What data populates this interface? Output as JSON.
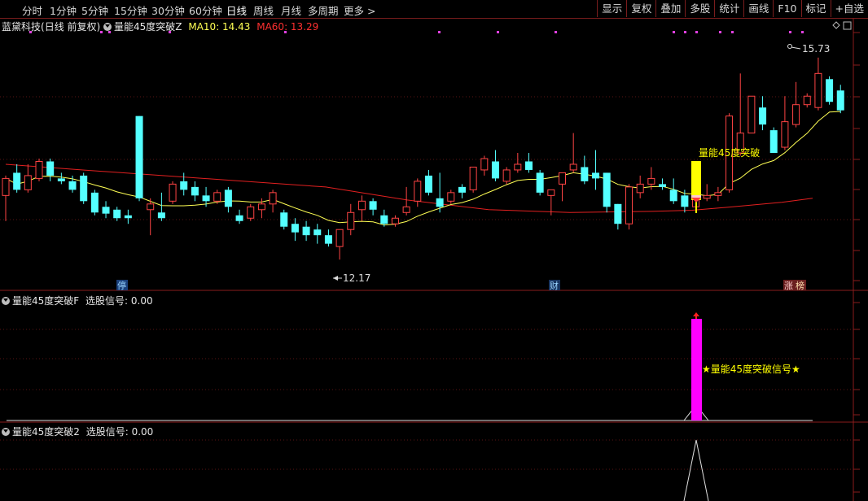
{
  "toolbar": {
    "timeframes": [
      "分时",
      "1分钟",
      "5分钟",
      "15分钟",
      "30分钟",
      "60分钟",
      "日线",
      "周线",
      "月线",
      "多周期",
      "更多 >"
    ],
    "active_timeframe": "日线",
    "tools": [
      "显示",
      "复权",
      "叠加",
      "多股",
      "统计",
      "画线",
      "F10",
      "标记",
      "+自选"
    ]
  },
  "main_pane": {
    "stock_name": "蓝黛科技",
    "period_label": "(日线 前复权)",
    "indicator_name": "量能45度突破Z",
    "ma10_label": "MA10: 14.43",
    "ma60_label": "MA60: 13.29",
    "high_annotation": "15.73",
    "low_annotation": "12.17",
    "signal_label": "量能45度突破",
    "badges": [
      "停",
      "财",
      "涨",
      "榜"
    ],
    "colors": {
      "up": "#ff4444",
      "down": "#54ffff",
      "ma10": "#ffff54",
      "ma60": "#e22020",
      "signal": "#ffff00",
      "dots": "#e040e0"
    }
  },
  "pane2": {
    "title": "量能45度突破F",
    "signal_text": "选股信号: 0.00",
    "bar_label": "★量能45度突破信号★",
    "bar_color": "#ff00ff"
  },
  "pane3": {
    "title": "量能45度突破2",
    "signal_text": "选股信号: 0.00"
  },
  "chart_data": {
    "type": "candlestick",
    "price_range": [
      11.8,
      16.2
    ],
    "candles": [
      [
        13.3,
        13.6,
        12.85,
        13.65
      ],
      [
        13.7,
        13.4,
        13.35,
        13.85
      ],
      [
        13.4,
        13.65,
        13.35,
        13.85
      ],
      [
        13.6,
        13.9,
        13.55,
        13.95
      ],
      [
        13.9,
        13.65,
        13.55,
        13.95
      ],
      [
        13.6,
        13.55,
        13.5,
        13.7
      ],
      [
        13.55,
        13.4,
        13.35,
        13.65
      ],
      [
        13.65,
        13.2,
        13.15,
        13.7
      ],
      [
        13.35,
        13.0,
        12.95,
        13.4
      ],
      [
        13.1,
        12.98,
        12.9,
        13.2
      ],
      [
        13.05,
        12.9,
        12.85,
        13.1
      ],
      [
        12.95,
        12.9,
        12.8,
        13.05
      ],
      [
        14.7,
        13.25,
        13.2,
        14.7
      ],
      [
        13.05,
        13.15,
        12.6,
        13.25
      ],
      [
        13.0,
        12.9,
        12.85,
        13.35
      ],
      [
        13.2,
        13.5,
        13.15,
        13.55
      ],
      [
        13.55,
        13.4,
        13.3,
        13.7
      ],
      [
        13.45,
        13.3,
        13.2,
        13.55
      ],
      [
        13.3,
        13.2,
        13.1,
        13.45
      ],
      [
        13.2,
        13.35,
        13.15,
        13.4
      ],
      [
        13.4,
        13.1,
        13.0,
        13.45
      ],
      [
        12.95,
        12.85,
        12.8,
        13.05
      ],
      [
        12.9,
        13.1,
        12.85,
        13.15
      ],
      [
        13.05,
        13.15,
        12.9,
        13.25
      ],
      [
        13.15,
        13.35,
        13.0,
        13.4
      ],
      [
        13.0,
        12.75,
        12.7,
        13.05
      ],
      [
        12.8,
        12.65,
        12.5,
        12.9
      ],
      [
        12.75,
        12.6,
        12.5,
        12.85
      ],
      [
        12.7,
        12.6,
        12.45,
        12.8
      ],
      [
        12.6,
        12.45,
        12.4,
        12.7
      ],
      [
        12.4,
        12.7,
        12.17,
        12.7
      ],
      [
        12.7,
        13.0,
        12.6,
        13.15
      ],
      [
        13.05,
        13.2,
        12.85,
        13.3
      ],
      [
        13.2,
        13.05,
        12.95,
        13.25
      ],
      [
        12.95,
        12.8,
        12.75,
        13.05
      ],
      [
        12.8,
        12.9,
        12.75,
        12.95
      ],
      [
        13.0,
        13.1,
        12.95,
        13.45
      ],
      [
        13.2,
        13.55,
        13.1,
        13.6
      ],
      [
        13.65,
        13.35,
        13.3,
        13.75
      ],
      [
        13.25,
        13.1,
        13.0,
        13.7
      ],
      [
        13.2,
        13.35,
        13.15,
        13.4
      ],
      [
        13.45,
        13.35,
        13.25,
        13.5
      ],
      [
        13.4,
        13.8,
        13.35,
        13.8
      ],
      [
        13.75,
        13.95,
        13.65,
        14.0
      ],
      [
        13.9,
        13.6,
        13.55,
        14.1
      ],
      [
        13.55,
        13.75,
        13.5,
        13.8
      ],
      [
        13.75,
        13.85,
        13.7,
        14.05
      ],
      [
        13.9,
        13.75,
        13.7,
        14.05
      ],
      [
        13.7,
        13.35,
        13.3,
        13.75
      ],
      [
        13.3,
        13.4,
        12.95,
        13.4
      ],
      [
        13.5,
        13.7,
        13.2,
        13.7
      ],
      [
        13.75,
        13.85,
        13.7,
        14.4
      ],
      [
        13.8,
        13.55,
        13.5,
        14.0
      ],
      [
        13.7,
        13.6,
        13.4,
        14.1
      ],
      [
        13.7,
        13.1,
        13.0,
        13.7
      ],
      [
        13.15,
        12.8,
        12.7,
        13.15
      ],
      [
        12.8,
        13.45,
        12.7,
        13.5
      ],
      [
        13.35,
        13.5,
        13.25,
        13.65
      ],
      [
        13.5,
        13.6,
        13.4,
        13.8
      ],
      [
        13.5,
        13.45,
        13.4,
        13.6
      ],
      [
        13.4,
        13.2,
        13.15,
        13.6
      ],
      [
        13.3,
        13.1,
        13.0,
        13.4
      ],
      [
        13.1,
        13.45,
        13.05,
        13.55
      ],
      [
        13.25,
        13.3,
        13.2,
        13.5
      ],
      [
        13.3,
        13.35,
        13.2,
        13.45
      ],
      [
        13.4,
        14.7,
        13.35,
        14.75
      ],
      [
        14.05,
        14.4,
        14.0,
        15.45
      ],
      [
        14.4,
        15.05,
        14.4,
        15.05
      ],
      [
        14.85,
        14.55,
        14.45,
        15.05
      ],
      [
        14.45,
        14.05,
        14.05,
        14.5
      ],
      [
        14.15,
        14.6,
        14.1,
        15.05
      ],
      [
        14.55,
        14.9,
        14.5,
        15.3
      ],
      [
        14.9,
        15.05,
        14.85,
        15.1
      ],
      [
        14.85,
        15.45,
        14.8,
        15.73
      ],
      [
        15.35,
        14.95,
        14.9,
        15.4
      ],
      [
        15.15,
        14.8,
        14.75,
        15.25
      ]
    ]
  }
}
